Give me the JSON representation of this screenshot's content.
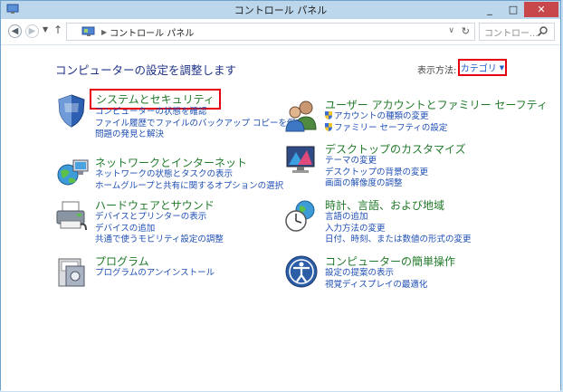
{
  "window": {
    "title": "コントロール パネル",
    "minimize_label": "_",
    "maximize_label": "□",
    "close_label": "✕"
  },
  "address": {
    "path": "コントロール パネル",
    "search_placeholder": "コントロー..."
  },
  "main": {
    "heading": "コンピューターの設定を調整します",
    "view_by_label": "表示方法:",
    "view_by_value": "カテゴリ",
    "categories_left": [
      {
        "title": "システムとセキュリティ",
        "icon": "shield-icon",
        "links": [
          "コンピューターの状態を確認",
          "ファイル履歴でファイルのバックアップ コピーを保存",
          "問題の発見と解決"
        ]
      },
      {
        "title": "ネットワークとインターネット",
        "icon": "network-globe-icon",
        "links": [
          "ネットワークの状態とタスクの表示",
          "ホームグループと共有に関するオプションの選択"
        ]
      },
      {
        "title": "ハードウェアとサウンド",
        "icon": "printer-icon",
        "links": [
          "デバイスとプリンターの表示",
          "デバイスの追加",
          "共通で使うモビリティ設定の調整"
        ]
      },
      {
        "title": "プログラム",
        "icon": "program-icon",
        "links": [
          "プログラムのアンインストール"
        ]
      }
    ],
    "categories_right": [
      {
        "title": "ユーザー アカウントとファミリー セーフティ",
        "icon": "users-icon",
        "links": [
          "アカウントの種類の変更",
          "ファミリー セーフティの設定"
        ]
      },
      {
        "title": "デスクトップのカスタマイズ",
        "icon": "desktop-icon",
        "links": [
          "テーマの変更",
          "デスクトップの背景の変更",
          "画面の解像度の調整"
        ]
      },
      {
        "title": "時計、言語、および地域",
        "icon": "clock-globe-icon",
        "links": [
          "言語の追加",
          "入力方法の変更",
          "日付、時刻、または数値の形式の変更"
        ]
      },
      {
        "title": "コンピューターの簡単操作",
        "icon": "ease-of-access-icon",
        "links": [
          "設定の提案の表示",
          "視覚ディスプレイの最適化"
        ]
      }
    ]
  },
  "colors": {
    "category_title": "#217a2a",
    "link": "#1f4fb4",
    "heading": "#1e3287",
    "highlight_box": "#e60012",
    "chrome": "#bcd6ec"
  }
}
